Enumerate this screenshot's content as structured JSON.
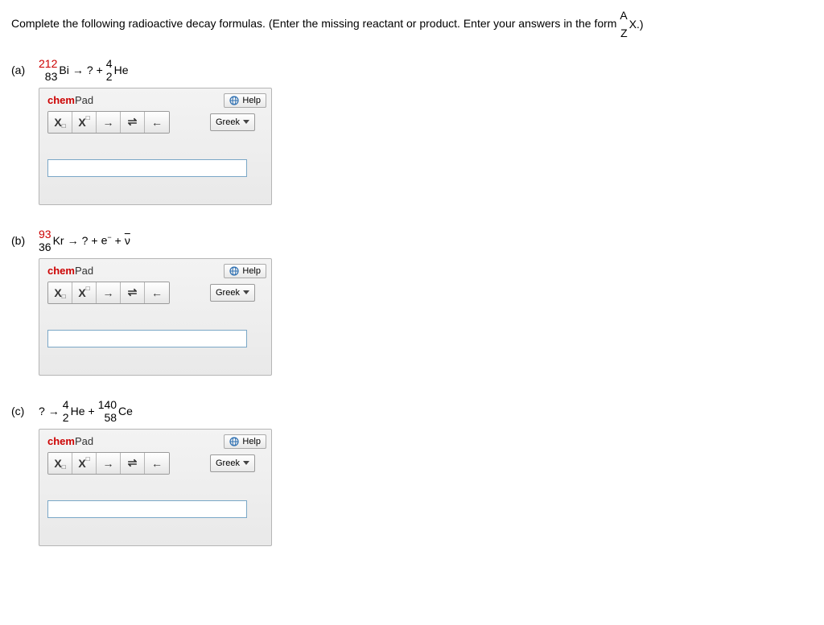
{
  "prompt": {
    "text_before": "Complete the following radioactive decay formulas. (Enter the missing reactant or product. Enter your answers in the form ",
    "form_A": "A",
    "form_Z": "Z",
    "form_X": "X.)"
  },
  "chempad": {
    "title_chem": "chem",
    "title_pad": "Pad",
    "help_label": "Help",
    "greek_label": "Greek",
    "tool_sub": "X",
    "tool_sub_mark": "□",
    "tool_sup": "X",
    "tool_sup_mark": "□",
    "tool_fwd": "→",
    "tool_equil": "⇌",
    "tool_back": "←"
  },
  "parts": {
    "a": {
      "label": "(a)",
      "n1_A": "212",
      "n1_Z": "83",
      "n1_sym": "Bi",
      "arrow": "→",
      "q": "?",
      "plus": "+",
      "n2_A": "4",
      "n2_Z": "2",
      "n2_sym": "He"
    },
    "b": {
      "label": "(b)",
      "n1_A": "93",
      "n1_Z": "36",
      "n1_sym": "Kr",
      "arrow": "→",
      "q": "?",
      "plus1": "+",
      "e": "e",
      "e_sup": "−",
      "plus2": "+",
      "nu": "ν"
    },
    "c": {
      "label": "(c)",
      "q": "?",
      "arrow": "→",
      "n1_A": "4",
      "n1_Z": "2",
      "n1_sym": "He",
      "plus": "+",
      "n2_A": "140",
      "n2_Z": "58",
      "n2_sym": "Ce"
    }
  }
}
